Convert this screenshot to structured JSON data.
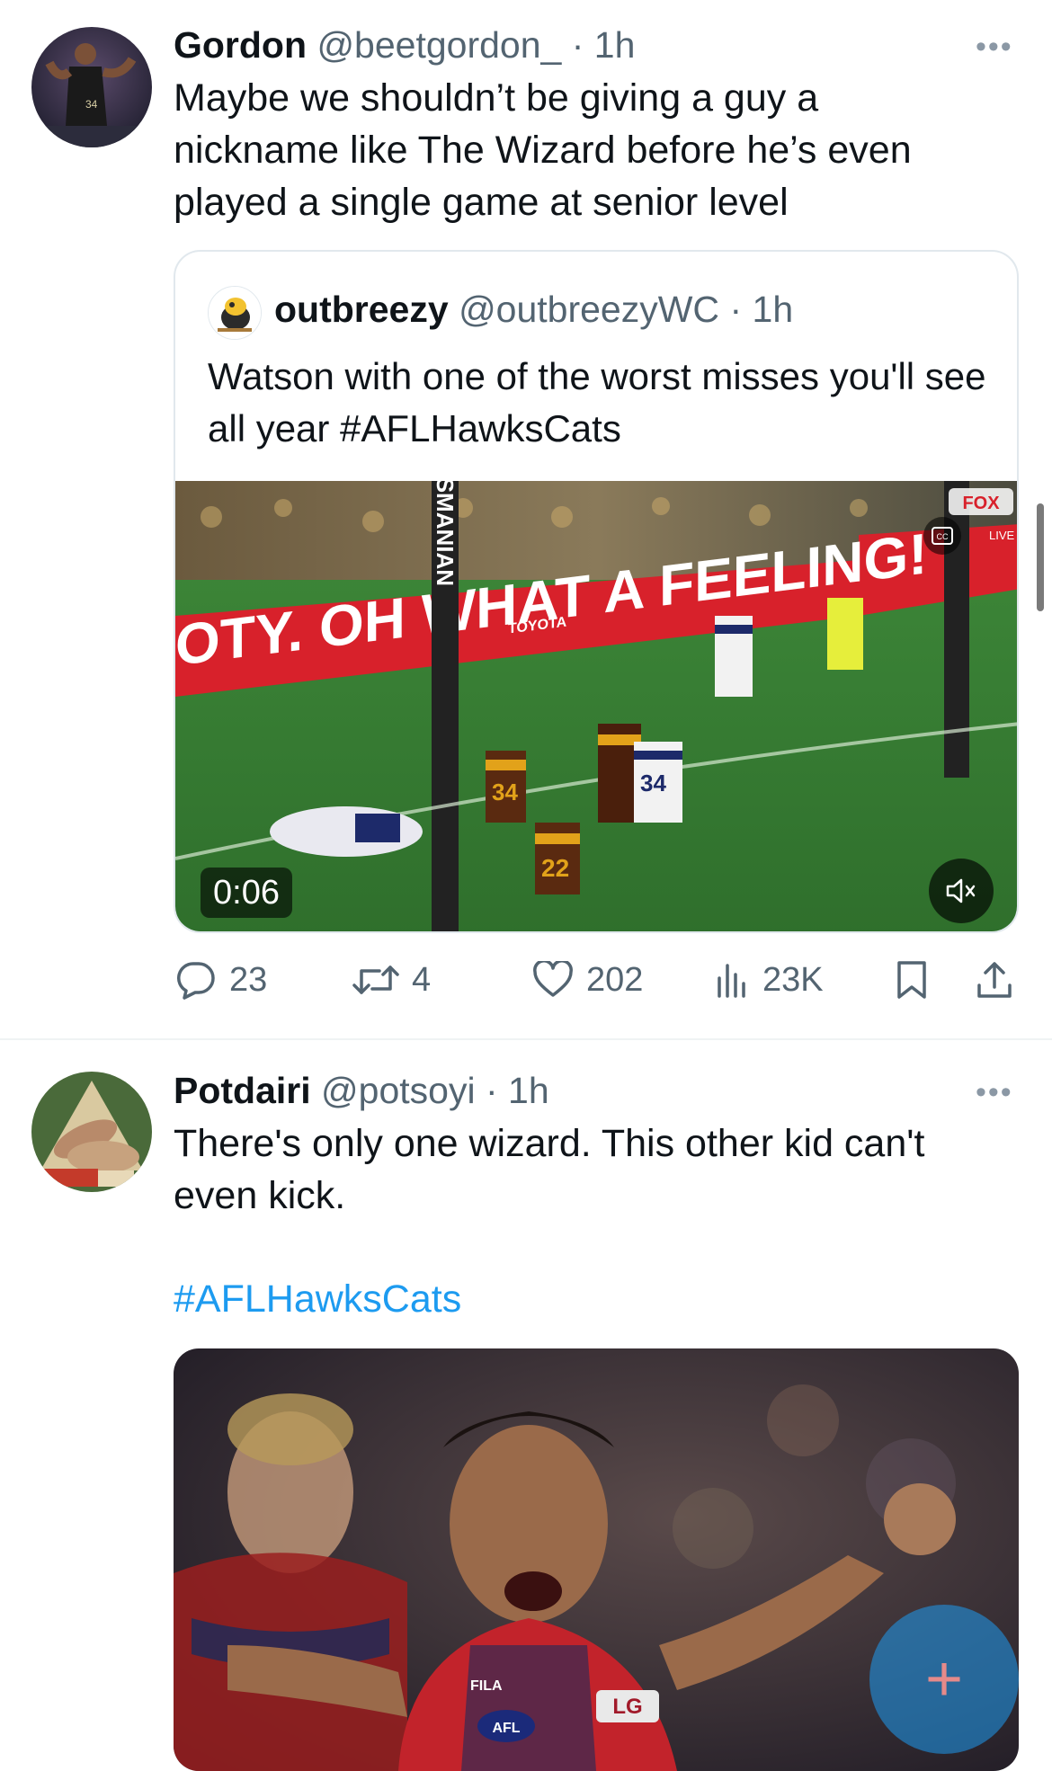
{
  "tweet1": {
    "display_name": "Gordon",
    "handle": "@beetgordon_",
    "sep": "·",
    "time": "1h",
    "more": "•••",
    "text": "Maybe we shouldn’t be giving a guy a nickname like The Wizard before he’s even played a single game at senior level",
    "quote": {
      "display_name": "outbreezy",
      "handle": "@outbreezyWC",
      "sep": "·",
      "time": "1h",
      "text": "Watson with one of the worst misses you'll see all year #AFLHawksCats",
      "video": {
        "duration": "0:06",
        "banner_text": "OTY. OH WHAT A FEELING!",
        "sponsor": "TOYOTA",
        "post_text": "TASMANIAN",
        "broadcaster": "FOX",
        "live_text": "LIVE",
        "jersey_numbers": [
          "34",
          "22",
          "34"
        ],
        "icons": [
          "mute-icon",
          "captions-icon"
        ]
      }
    },
    "actions": {
      "replies": "23",
      "retweets": "4",
      "likes": "202",
      "views": "23K"
    }
  },
  "tweet2": {
    "display_name": "Potdairi",
    "handle": "@potsoyi",
    "sep": "·",
    "time": "1h",
    "more": "•••",
    "text": "There's only one wizard. This other kid can't even kick.",
    "hashtag": "#AFLHawksCats",
    "photo": {
      "sponsors": [
        "FILA",
        "LG",
        "AFL"
      ]
    }
  },
  "fab": {
    "label": "+"
  },
  "colors": {
    "link": "#1d9bf0",
    "secondary_text": "#536471",
    "primary_text": "#0f1419",
    "border": "#e1e8ed"
  }
}
